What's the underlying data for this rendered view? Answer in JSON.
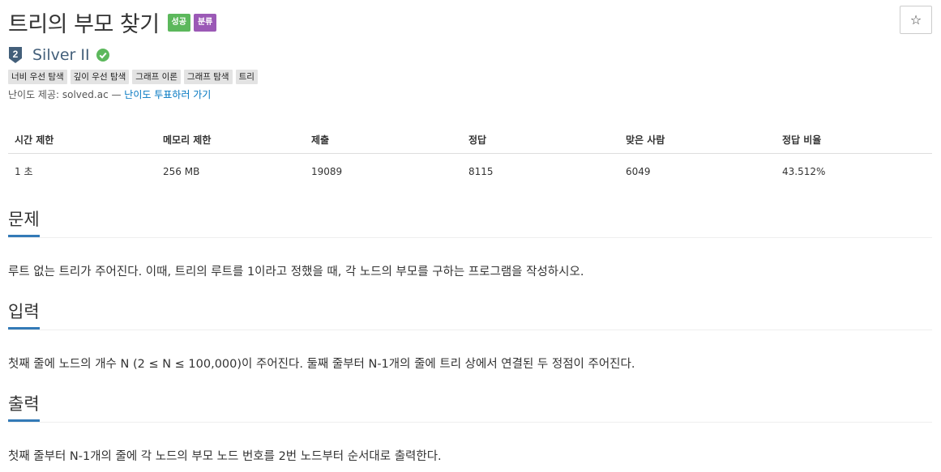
{
  "problem": {
    "title": "트리의 부모 찾기",
    "badges": [
      "성공",
      "분류"
    ],
    "tier": "Silver II",
    "tier_number": "2",
    "tags": [
      "너비 우선 탐색",
      "깊이 우선 탐색",
      "그래프 이론",
      "그래프 탐색",
      "트리"
    ],
    "provider_prefix": "난이도 제공: solved.ac — ",
    "provider_link": "난이도 투표하러 가기",
    "star_icon": "☆"
  },
  "info_table": {
    "headers": [
      "시간 제한",
      "메모리 제한",
      "제출",
      "정답",
      "맞은 사람",
      "정답 비율"
    ],
    "values": [
      "1 초",
      "256 MB",
      "19089",
      "8115",
      "6049",
      "43.512%"
    ]
  },
  "sections": {
    "problem": {
      "title": "문제",
      "text": "루트 없는 트리가 주어진다. 이때, 트리의 루트를 1이라고 정했을 때, 각 노드의 부모를 구하는 프로그램을 작성하시오."
    },
    "input": {
      "title": "입력",
      "text": "첫째 줄에 노드의 개수 N (2 ≤ N ≤ 100,000)이 주어진다. 둘째 줄부터 N-1개의 줄에 트리 상에서 연결된 두 정점이 주어진다."
    },
    "output": {
      "title": "출력",
      "text": "첫째 줄부터 N-1개의 줄에 각 노드의 부모 노드 번호를 2번 노드부터 순서대로 출력한다."
    }
  },
  "colors": {
    "success": "#5cb85c",
    "category": "#9b59b6",
    "tier": "#435f7a",
    "link": "#0076c0",
    "section_underline": "#337ab7"
  }
}
